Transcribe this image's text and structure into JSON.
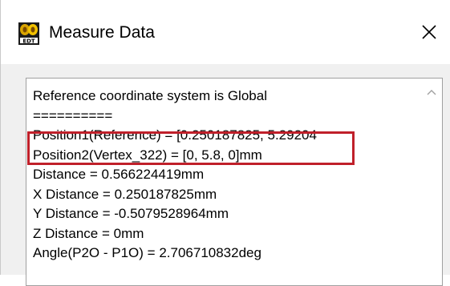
{
  "window": {
    "title": "Measure Data",
    "icon": "edt-app-icon",
    "close_icon": "close-icon"
  },
  "output": {
    "lines": [
      "Reference coordinate system is Global",
      "==========",
      "Position1(Reference) = [0.250187825, 5.29204",
      "Position2(Vertex_322) = [0, 5.8, 0]mm",
      "Distance = 0.566224419mm",
      "X Distance = 0.250187825mm",
      "Y Distance = -0.5079528964mm",
      "Z Distance = 0mm",
      "Angle(P2O - P1O) = 2.706710832deg"
    ],
    "highlighted_line_index": 3
  },
  "colors": {
    "highlight": "#c0202a",
    "panel_bg": "#f0f0f0",
    "text": "#000000"
  }
}
